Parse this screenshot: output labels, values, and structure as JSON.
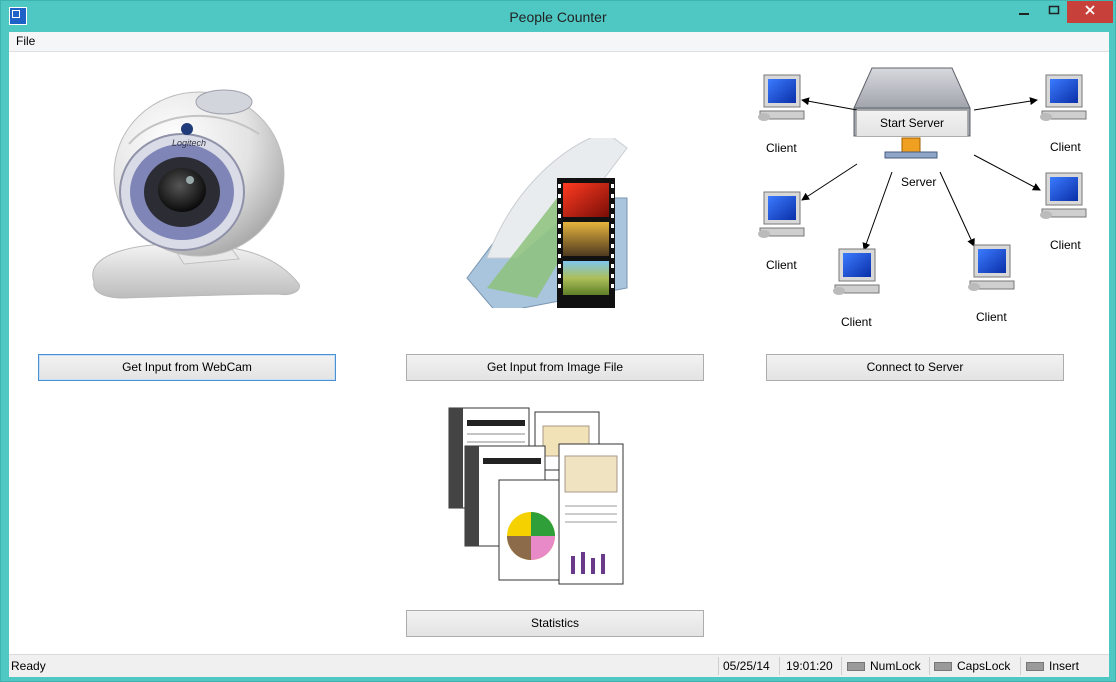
{
  "window": {
    "title": "People Counter"
  },
  "menu": {
    "file": "File"
  },
  "main": {
    "buttons": {
      "webcam": "Get Input from WebCam",
      "image_file": "Get Input from Image File",
      "server": "Connect to Server",
      "statistics": "Statistics"
    },
    "server_diagram": {
      "start_server": "Start Server",
      "server_label": "Server",
      "clients": [
        "Client",
        "Client",
        "Client",
        "Client",
        "Client",
        "Client"
      ]
    },
    "webcam_image": {
      "brand": "Logitech"
    }
  },
  "status": {
    "ready": "Ready",
    "date": "05/25/14",
    "time": "19:01:20",
    "numlock": "NumLock",
    "capslock": "CapsLock",
    "insert": "Insert"
  },
  "colors": {
    "accent": "#4fc8c4",
    "close": "#c7413a",
    "focus": "#4a90d0"
  }
}
